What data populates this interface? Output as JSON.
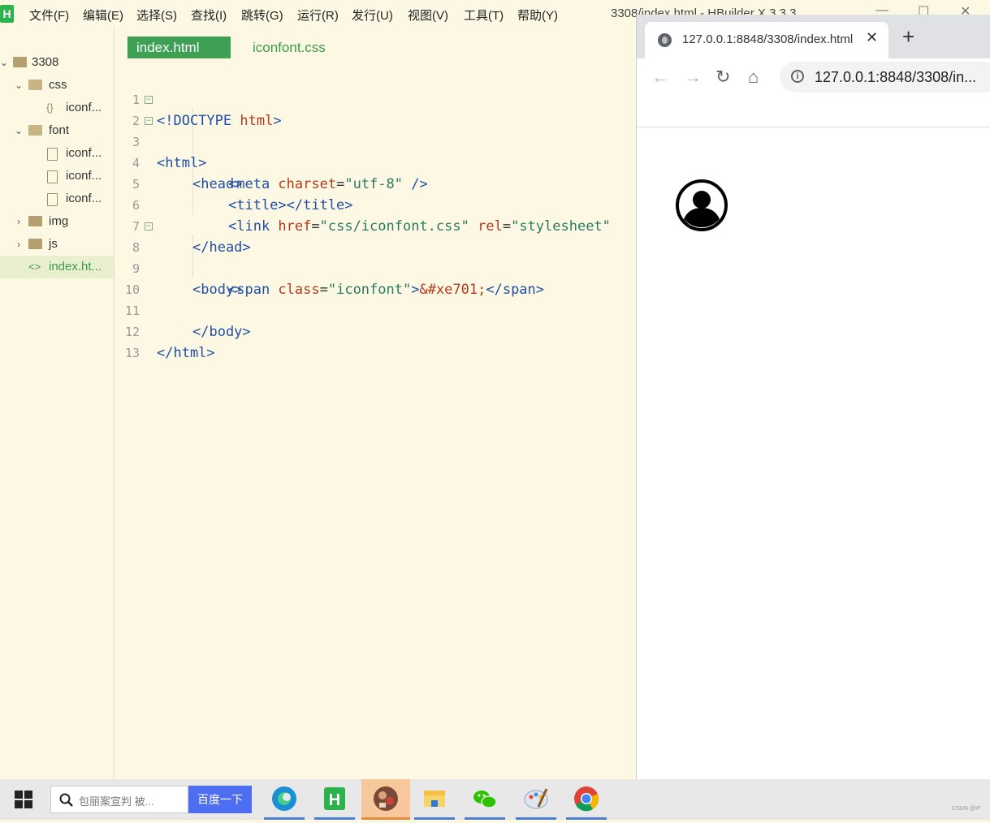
{
  "window": {
    "title": "3308/index.html - HBuilder X 3.3.3",
    "app_logo": "H",
    "controls": [
      "—",
      "☐",
      "✕"
    ]
  },
  "menu": [
    "文件(F)",
    "编辑(E)",
    "选择(S)",
    "查找(I)",
    "跳转(G)",
    "运行(R)",
    "发行(U)",
    "视图(V)",
    "工具(T)",
    "帮助(Y)"
  ],
  "tree": {
    "project": "3308",
    "items": [
      {
        "label": "css"
      },
      {
        "label": "iconf..."
      },
      {
        "label": "font"
      },
      {
        "label": "iconf..."
      },
      {
        "label": "iconf..."
      },
      {
        "label": "iconf..."
      },
      {
        "label": "img"
      },
      {
        "label": "js"
      },
      {
        "label": "index.ht..."
      }
    ]
  },
  "tabs": {
    "active": "index.html",
    "inactive": "iconfont.css"
  },
  "code": {
    "line_numbers": [
      "1",
      "2",
      "3",
      "4",
      "5",
      "6",
      "7",
      "8",
      "9",
      "10",
      "11",
      "12",
      "13"
    ],
    "l1": {
      "a": "<!DOCTYPE ",
      "b": "html",
      "c": ">"
    },
    "l2": "<html>",
    "l3": "<head>",
    "l4": {
      "a": "<meta ",
      "b": "charset",
      "c": "=",
      "d": "\"utf-8\"",
      "e": " />"
    },
    "l5": "<title></title>",
    "l6": {
      "a": "<link ",
      "b": "href",
      "c": "=",
      "d": "\"css/iconfont.css\"",
      "e": " ",
      "f": "rel",
      "g": "=",
      "h": "\"stylesheet\""
    },
    "l7": "</head>",
    "l8": "<body>",
    "l9": {
      "a": "<span ",
      "b": "class",
      "c": "=",
      "d": "\"iconfont\"",
      "e": ">",
      "f": "&#xe701;",
      "g": "</span>"
    },
    "l11": "</body>",
    "l12": "</html>"
  },
  "browser": {
    "tab_title": "127.0.0.1:8848/3308/index.html",
    "close": "✕",
    "new_tab": "+",
    "url_host": "127.0.0.1",
    "url_rest": ":8848/3308/in...",
    "page_icon": "user-circle-icon"
  },
  "taskbar": {
    "search_placeholder": "包丽案宣判 被...",
    "baidu_button": "百度一下",
    "apps": [
      "edge-icon",
      "hbuilderx-icon",
      "photo-icon",
      "explorer-icon",
      "wechat-icon",
      "paint-icon",
      "chrome-icon"
    ],
    "watermark": "CSDN @IP"
  }
}
